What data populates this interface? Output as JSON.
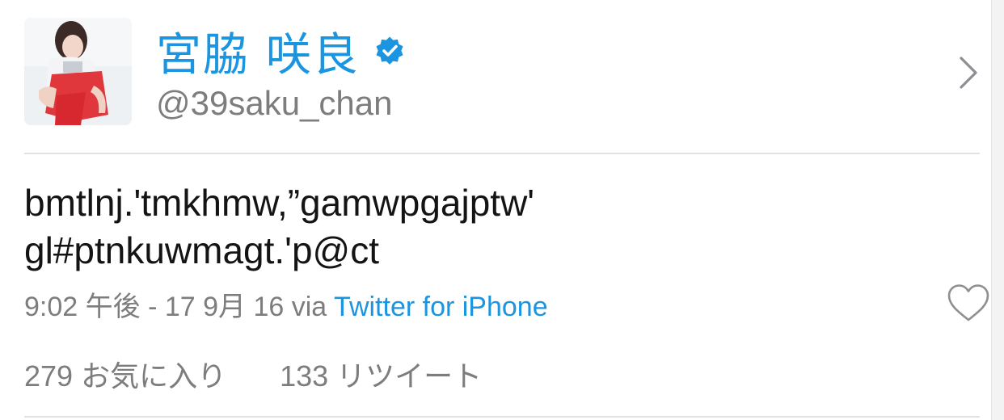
{
  "profile": {
    "display_name": "宮脇 咲良",
    "handle": "@39saku_chan",
    "avatar_icon": "profile-photo",
    "verified_icon": "verified-badge-icon"
  },
  "tweet": {
    "text_line_1": "bmtlnj.'tmkhmw,”gamwpgajptw'",
    "text_line_2": "gl#ptnkuwmagt.'p@ct"
  },
  "meta": {
    "timestamp": "9:02 午後 - 17 9月 16",
    "via_label": "via",
    "client": "Twitter for iPhone"
  },
  "stats": {
    "likes": "279 お気に入り",
    "retweets": "133 リツイート"
  },
  "colors": {
    "accent": "#1b95e0",
    "secondary_text": "#7d7d7d",
    "primary_text": "#141414"
  }
}
